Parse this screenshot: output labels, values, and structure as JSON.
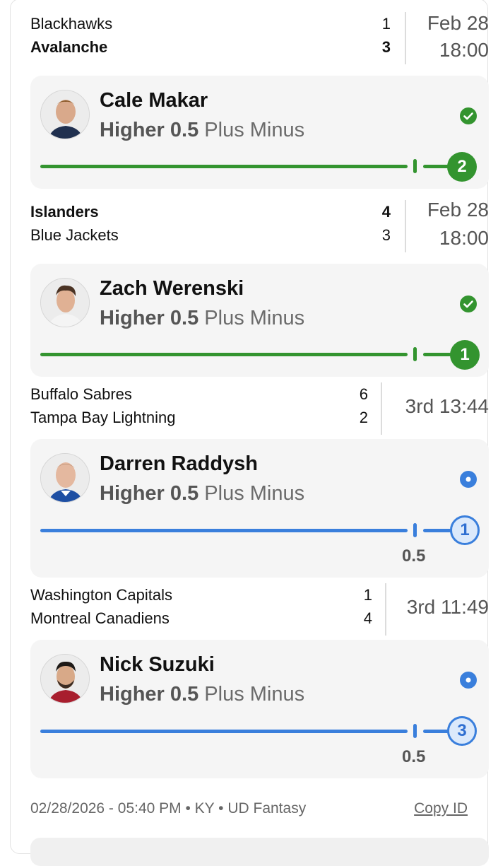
{
  "games": [
    {
      "team1": "Blackhawks",
      "score1": "1",
      "team2": "Avalanche",
      "score2": "3",
      "date": "Feb 28",
      "time": "18:00"
    },
    {
      "team1": "Islanders",
      "score1": "4",
      "team2": "Blue Jackets",
      "score2": "3",
      "date": "Feb 28",
      "time": "18:00"
    },
    {
      "team1": "Buffalo Sabres",
      "score1": "6",
      "team2": "Tampa Bay Lightning",
      "score2": "2",
      "clock": "3rd 13:44"
    },
    {
      "team1": "Washington Capitals",
      "score1": "1",
      "team2": "Montreal Canadiens",
      "score2": "4",
      "clock": "3rd 11:49"
    }
  ],
  "picks": [
    {
      "player": "Cale Makar",
      "direction": "Higher",
      "line": "0.5",
      "stat": "Plus Minus",
      "current": "2",
      "status": "won"
    },
    {
      "player": "Zach Werenski",
      "direction": "Higher",
      "line": "0.5",
      "stat": "Plus Minus",
      "current": "1",
      "status": "won"
    },
    {
      "player": "Darren Raddysh",
      "direction": "Higher",
      "line": "0.5",
      "stat": "Plus Minus",
      "current": "1",
      "status": "live",
      "line_label": "0.5"
    },
    {
      "player": "Nick Suzuki",
      "direction": "Higher",
      "line": "0.5",
      "stat": "Plus Minus",
      "current": "3",
      "status": "live",
      "line_label": "0.5"
    }
  ],
  "footer": {
    "meta": "02/28/2026 - 05:40 PM • KY • UD Fantasy",
    "copy_id": "Copy ID"
  },
  "colors": {
    "won": "#33942f",
    "live": "#3a7fdc"
  }
}
